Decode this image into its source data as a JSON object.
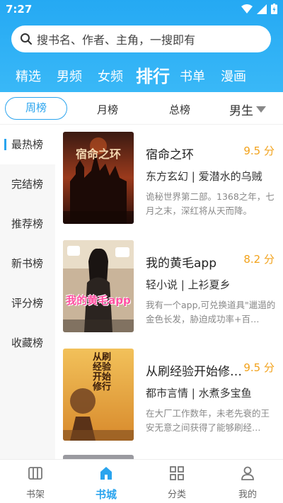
{
  "status_bar": {
    "time": "7:27",
    "icons": [
      "wifi-icon",
      "signal-icon",
      "battery-charging-icon"
    ]
  },
  "search": {
    "placeholder": "搜书名、作者、主角，一搜即有"
  },
  "categories": [
    {
      "label": "精选",
      "active": false
    },
    {
      "label": "男频",
      "active": false
    },
    {
      "label": "女频",
      "active": false
    },
    {
      "label": "排行",
      "active": true
    },
    {
      "label": "书单",
      "active": false
    },
    {
      "label": "漫画",
      "active": false
    }
  ],
  "rank_tabs": [
    {
      "label": "周榜",
      "active": true
    },
    {
      "label": "月榜",
      "active": false
    },
    {
      "label": "总榜",
      "active": false
    }
  ],
  "gender_filter": {
    "label": "男生"
  },
  "sidebar": [
    {
      "label": "最热榜",
      "active": true
    },
    {
      "label": "完结榜",
      "active": false
    },
    {
      "label": "推荐榜",
      "active": false
    },
    {
      "label": "新书榜",
      "active": false
    },
    {
      "label": "评分榜",
      "active": false
    },
    {
      "label": "收藏榜",
      "active": false
    }
  ],
  "books": [
    {
      "title": "宿命之环",
      "score": "9.5 分",
      "genre": "东方玄幻",
      "author": "爱潜水的乌贼",
      "description": "诡秘世界第二部。1368之年，七月之末，深红将从天而降。",
      "cover_text": "宿命之环"
    },
    {
      "title": "我的黄毛app",
      "score": "8.2 分",
      "genre": "轻小说",
      "author": "上衫夏乡",
      "description": "我有一个app,可兑换道具\"邋遢的金色长发，胁迫成功率+百…",
      "cover_text": "我的黄毛app"
    },
    {
      "title": "从刷经验开始修…",
      "score": "9.5 分",
      "genre": "都市言情",
      "author": "水煮多宝鱼",
      "description": "在大厂工作数年，未老先衰的王安无意之间获得了能够刷经…",
      "cover_text": "从刷经验开始修行"
    }
  ],
  "bottom_nav": [
    {
      "label": "书架",
      "icon": "bookshelf-icon",
      "active": false
    },
    {
      "label": "书城",
      "icon": "bookstore-icon",
      "active": true
    },
    {
      "label": "分类",
      "icon": "category-grid-icon",
      "active": false
    },
    {
      "label": "我的",
      "icon": "profile-icon",
      "active": false
    }
  ],
  "colors": {
    "accent": "#2aa4ee",
    "header": "#25a9f3",
    "score": "#f2a21b"
  }
}
